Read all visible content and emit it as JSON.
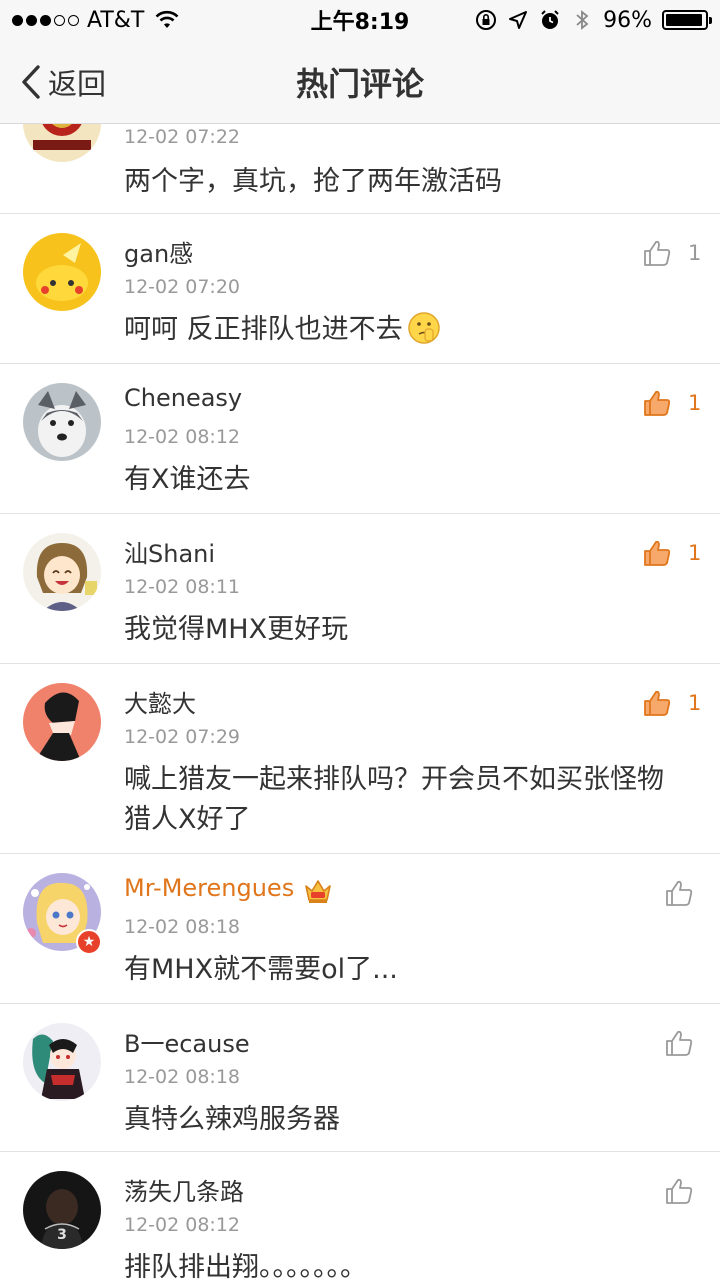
{
  "status_bar": {
    "carrier": "AT&T",
    "time": "上午8:19",
    "battery": "96%",
    "battery_level": 0.96
  },
  "nav": {
    "back_label": "返回",
    "title": "热门评论"
  },
  "colors": {
    "accent": "#e0761c",
    "text": "#333333",
    "muted": "#999999"
  },
  "comments": [
    {
      "name": "",
      "time": "12-02 07:22",
      "text": "两个字，真坑，抢了两年激活码",
      "likes": null,
      "liked": false
    },
    {
      "name": "gan感",
      "time": "12-02 07:20",
      "text": "呵呵 反正排队也进不去",
      "emoji": "thinking-emoji",
      "likes": "1",
      "liked": false
    },
    {
      "name": "Cheneasy",
      "time": "12-02 08:12",
      "text": "有X谁还去",
      "likes": "1",
      "liked": true
    },
    {
      "name": "汕Shani",
      "time": "12-02 08:11",
      "text": "我觉得MHX更好玩",
      "likes": "1",
      "liked": true
    },
    {
      "name": "大懿大",
      "time": "12-02 07:29",
      "text": "喊上猎友一起来排队吗？开会员不如买张怪物猎人X好了",
      "likes": "1",
      "liked": true
    },
    {
      "name": "Mr-Merengues",
      "time": "12-02 08:18",
      "text": "有MHX就不需要ol了...",
      "likes": "",
      "liked": false,
      "vip": true
    },
    {
      "name": "B一ecause",
      "time": "12-02 08:18",
      "text": "真特么辣鸡服务器",
      "likes": "",
      "liked": false
    },
    {
      "name": "荡失几条路",
      "time": "12-02 08:12",
      "text": "排队排出翔。。。。。。。",
      "likes": "",
      "liked": false
    }
  ]
}
